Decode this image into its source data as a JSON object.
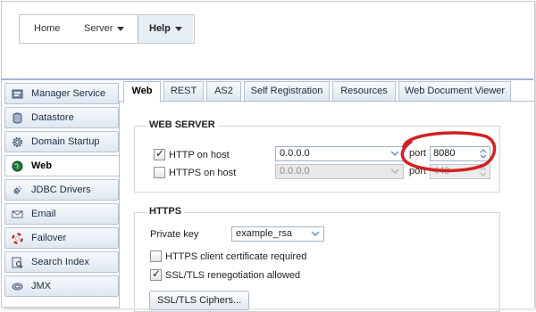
{
  "menu": {
    "items": [
      {
        "label": "Home"
      },
      {
        "label": "Server"
      },
      {
        "label": "Help"
      }
    ]
  },
  "sidebar": {
    "items": [
      {
        "label": "Manager Service",
        "icon": "manager-icon"
      },
      {
        "label": "Datastore",
        "icon": "database-icon"
      },
      {
        "label": "Domain Startup",
        "icon": "gear-icon"
      },
      {
        "label": "Web",
        "icon": "globe-icon",
        "active": true
      },
      {
        "label": "JDBC Drivers",
        "icon": "plug-icon"
      },
      {
        "label": "Email",
        "icon": "envelope-icon"
      },
      {
        "label": "Failover",
        "icon": "lifebuoy-icon"
      },
      {
        "label": "Search Index",
        "icon": "search-index-icon"
      },
      {
        "label": "JMX",
        "icon": "jmx-icon"
      }
    ]
  },
  "tabs": [
    {
      "label": "Web",
      "active": true
    },
    {
      "label": "REST"
    },
    {
      "label": "AS2"
    },
    {
      "label": "Self Registration"
    },
    {
      "label": "Resources"
    },
    {
      "label": "Web Document Viewer"
    }
  ],
  "web_server": {
    "legend": "WEB SERVER",
    "http": {
      "label": "HTTP on host",
      "checked": true,
      "host": "0.0.0.0",
      "port_label": "port",
      "port": "8080"
    },
    "https": {
      "label": "HTTPS on host",
      "checked": false,
      "host": "0.0.0.0",
      "port_label": "port",
      "port": "443"
    }
  },
  "https_section": {
    "legend": "HTTPS",
    "private_key_label": "Private key",
    "private_key_value": "example_rsa",
    "client_cert": {
      "label": "HTTPS client certificate required",
      "checked": false
    },
    "renegotiation": {
      "label": "SSL/TLS renegotiation allowed",
      "checked": true
    },
    "ciphers_button": "SSL/TLS Ciphers..."
  },
  "colors": {
    "highlight": "#d42020",
    "accent": "#9fb6d3"
  }
}
